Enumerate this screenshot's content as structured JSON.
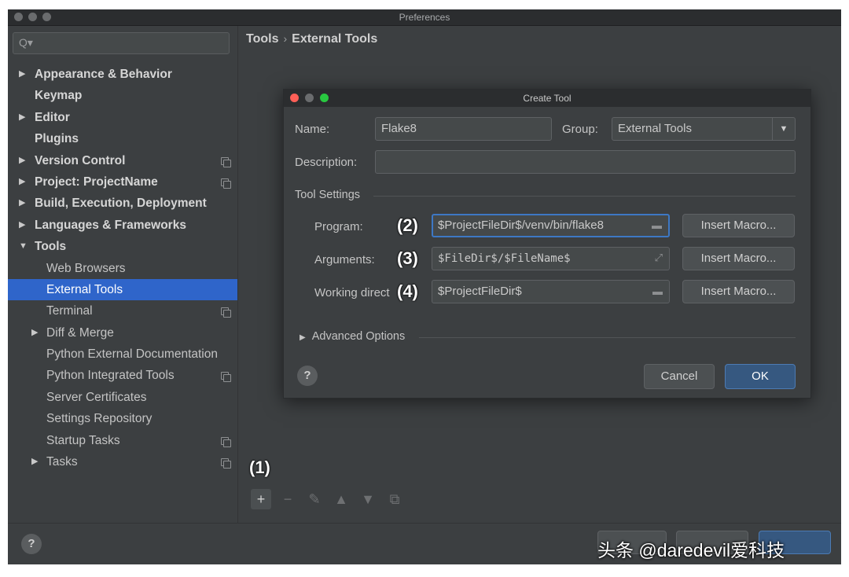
{
  "window": {
    "title": "Preferences"
  },
  "search": {
    "placeholder": "Q▾",
    "icon": "search-icon"
  },
  "sidebar": {
    "items": [
      {
        "label": "Appearance & Behavior",
        "level": 0,
        "arrow": "▶",
        "copy": false
      },
      {
        "label": "Keymap",
        "level": 0,
        "arrow": "",
        "copy": false
      },
      {
        "label": "Editor",
        "level": 0,
        "arrow": "▶",
        "copy": false
      },
      {
        "label": "Plugins",
        "level": 0,
        "arrow": "",
        "copy": false
      },
      {
        "label": "Version Control",
        "level": 0,
        "arrow": "▶",
        "copy": true
      },
      {
        "label": "Project: ProjectName",
        "level": 0,
        "arrow": "▶",
        "copy": true
      },
      {
        "label": "Build, Execution, Deployment",
        "level": 0,
        "arrow": "▶",
        "copy": false
      },
      {
        "label": "Languages & Frameworks",
        "level": 0,
        "arrow": "▶",
        "copy": false
      },
      {
        "label": "Tools",
        "level": 0,
        "arrow": "▼",
        "copy": false
      },
      {
        "label": "Web Browsers",
        "level": 1,
        "arrow": "",
        "copy": false
      },
      {
        "label": "External Tools",
        "level": 1,
        "arrow": "",
        "copy": false,
        "selected": true
      },
      {
        "label": "Terminal",
        "level": 1,
        "arrow": "",
        "copy": true
      },
      {
        "label": "Diff & Merge",
        "level": 1,
        "arrow": "▶",
        "copy": false
      },
      {
        "label": "Python External Documentation",
        "level": 1,
        "arrow": "",
        "copy": false
      },
      {
        "label": "Python Integrated Tools",
        "level": 1,
        "arrow": "",
        "copy": true
      },
      {
        "label": "Server Certificates",
        "level": 1,
        "arrow": "",
        "copy": false
      },
      {
        "label": "Settings Repository",
        "level": 1,
        "arrow": "",
        "copy": false
      },
      {
        "label": "Startup Tasks",
        "level": 1,
        "arrow": "",
        "copy": true
      },
      {
        "label": "Tasks",
        "level": 1,
        "arrow": "▶",
        "copy": true
      }
    ]
  },
  "breadcrumb": {
    "part1": "Tools",
    "separator": "›",
    "part2": "External Tools"
  },
  "toolbar": {
    "add": "+",
    "remove": "−",
    "edit": "✎",
    "up": "▲",
    "down": "▼",
    "copy": "⧉",
    "annotation": "(1)"
  },
  "bottom": {
    "help": "?"
  },
  "dialog": {
    "title": "Create Tool",
    "name_label": "Name:",
    "name_value": "Flake8",
    "group_label": "Group:",
    "group_value": "External Tools",
    "description_label": "Description:",
    "description_value": "",
    "tool_settings": "Tool Settings",
    "program_label": "Program:",
    "program_value": "$ProjectFileDir$/venv/bin/flake8",
    "program_annotation": "(2)",
    "arguments_label": "Arguments:",
    "arguments_value": "$FileDir$/$FileName$",
    "arguments_annotation": "(3)",
    "workdir_label": "Working direct",
    "workdir_value": "$ProjectFileDir$",
    "workdir_annotation": "(4)",
    "insert_macro": "Insert Macro...",
    "advanced": "Advanced Options",
    "help": "?",
    "cancel": "Cancel",
    "ok": "OK"
  },
  "watermark": "头条 @daredevil爱科技",
  "colors": {
    "selected": "#2f65ca",
    "ok_button": "#365880",
    "focus_border": "#3d78c4"
  }
}
